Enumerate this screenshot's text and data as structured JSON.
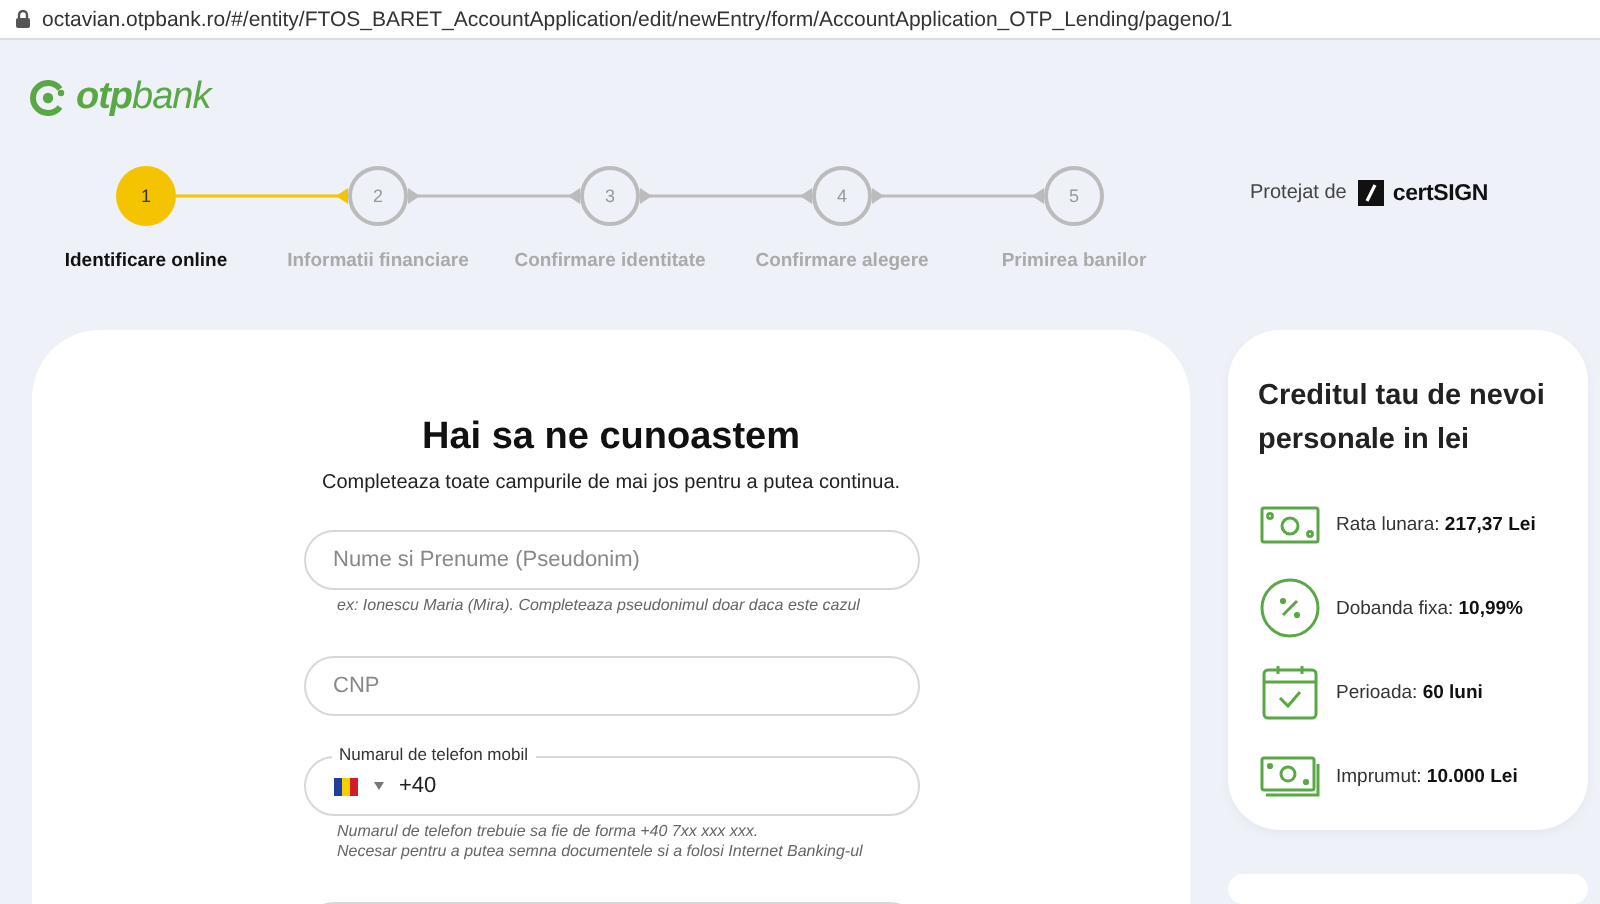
{
  "address_bar": {
    "url": "octavian.otpbank.ro/#/entity/FTOS_BARET_AccountApplication/edit/newEntry/form/AccountApplication_OTP_Lending/pageno/1"
  },
  "header": {
    "logo": "**otp**bank",
    "protected_by": "Protejat de",
    "cert_logo": "certSIGN"
  },
  "steps": [
    {
      "number": "1",
      "label": "Identificare online",
      "selected": true
    },
    {
      "number": "2",
      "label": "Informatii financiare",
      "selected": false
    },
    {
      "number": "3",
      "label": "Confirmare identitate",
      "selected": false
    },
    {
      "number": "4",
      "label": "Confirmare alegere",
      "selected": false
    },
    {
      "number": "5",
      "label": "Primirea banilor",
      "selected": false
    }
  ],
  "form": {
    "title": "Hai sa ne cunoastem",
    "subtitle": "Completeaza toate campurile de mai jos pentru a putea continua.",
    "fields": [
      {
        "kind": "text",
        "placeholder": "Nume si Prenume (Pseudonim)",
        "hints": [
          "ex: Ionescu Maria (Mira). Completeaza pseudonimul doar daca este cazul"
        ]
      },
      {
        "kind": "text",
        "placeholder": "CNP"
      },
      {
        "kind": "phone",
        "label": "Numarul de telefon mobil",
        "value": "+40",
        "hints": [
          "Numarul de telefon trebuie sa fie de forma +40 7xx xxx xxx.",
          "Necesar pentru a putea semna documentele si a folosi Internet Banking-ul"
        ]
      },
      {
        "kind": "text"
      }
    ]
  },
  "summary": {
    "title": "Creditul tau de nevoi personale in lei",
    "items": [
      {
        "kind": "banknote",
        "text": "Rata lunara: **217,37 Lei**"
      },
      {
        "kind": "percent",
        "text": "Dobanda fixa: **10,99%**"
      },
      {
        "kind": "calendar",
        "text": "Perioada: **60 luni**"
      },
      {
        "kind": "banknotes",
        "text": "Imprumut: **10.000 Lei**"
      }
    ]
  }
}
